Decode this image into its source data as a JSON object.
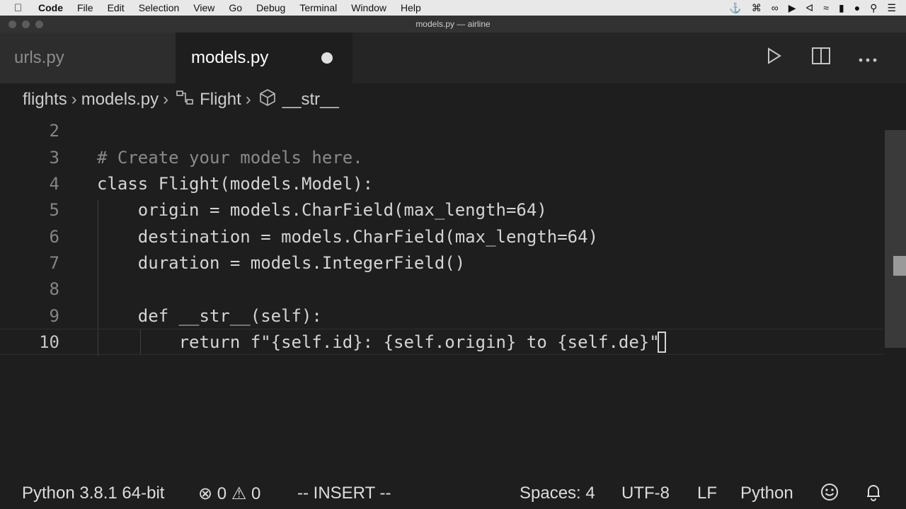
{
  "menubar": {
    "items": [
      "Code",
      "File",
      "Edit",
      "Selection",
      "View",
      "Go",
      "Debug",
      "Terminal",
      "Window",
      "Help"
    ]
  },
  "window": {
    "title": "models.py — airline"
  },
  "tabs": [
    {
      "label": "urls.py",
      "active": false
    },
    {
      "label": "models.py",
      "active": true,
      "dirty": true
    }
  ],
  "breadcrumb": [
    "flights",
    "models.py",
    "Flight",
    "__str__"
  ],
  "editor": {
    "lines": [
      {
        "num": "2",
        "text": ""
      },
      {
        "num": "3",
        "text": "# Create your models here."
      },
      {
        "num": "4",
        "text": "class Flight(models.Model):"
      },
      {
        "num": "5",
        "text": "    origin = models.CharField(max_length=64)"
      },
      {
        "num": "6",
        "text": "    destination = models.CharField(max_length=64)"
      },
      {
        "num": "7",
        "text": "    duration = models.IntegerField()"
      },
      {
        "num": "8",
        "text": ""
      },
      {
        "num": "9",
        "text": "    def __str__(self):"
      },
      {
        "num": "10",
        "text": "        return f\"{self.id}: {self.origin} to {self.de}\""
      }
    ]
  },
  "status": {
    "interpreter": "Python 3.8.1 64-bit",
    "errors": "0",
    "warnings": "0",
    "mode": "-- INSERT --",
    "spaces": "Spaces: 4",
    "encoding": "UTF-8",
    "eol": "LF",
    "language": "Python"
  },
  "colors": {
    "editor_bg": "#1e1e1e",
    "tab_inactive_bg": "#2d2d2d",
    "menubar_bg": "#e8e8e8"
  }
}
